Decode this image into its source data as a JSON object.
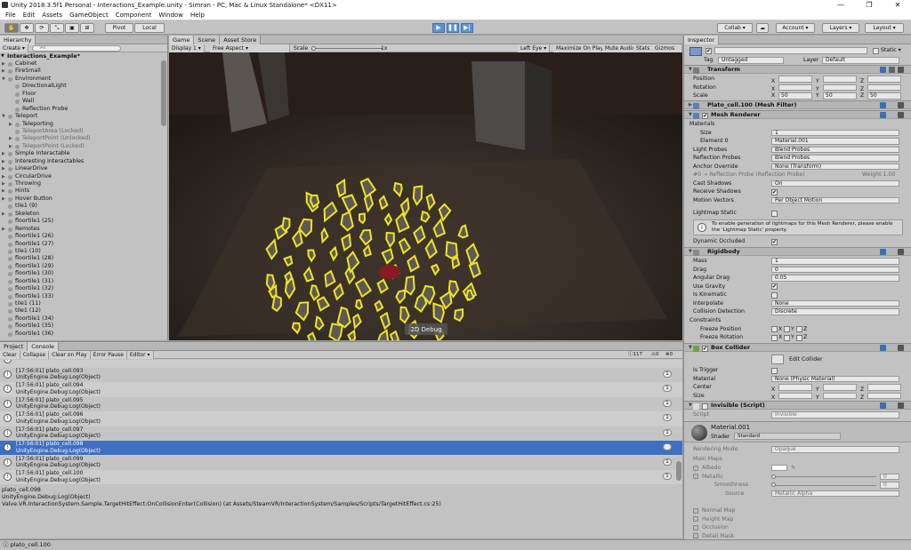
{
  "window": {
    "title": "Unity 2018.3.5f1 Personal - Interactions_Example.unity - Simran - PC, Mac & Linux Standalone* <DX11>",
    "min": "—",
    "max": "❐",
    "close": "✕"
  },
  "menu": [
    "File",
    "Edit",
    "Assets",
    "GameObject",
    "Component",
    "Window",
    "Help"
  ],
  "toolbar": {
    "pivot": "Pivot",
    "local": "Local",
    "collab": "Collab ▾",
    "account": "Account ▾",
    "layers": "Layers ▾",
    "layout": "Layout ▾"
  },
  "hierarchy": {
    "tab": "Hierarchy",
    "create": "Create ▾",
    "search": "All",
    "root": "Interactions_Example*",
    "items": [
      {
        "label": "Cabinet",
        "indent": 1,
        "arrow": true
      },
      {
        "label": "FireSmall",
        "indent": 1,
        "arrow": true
      },
      {
        "label": "Environment",
        "indent": 1,
        "arrow": true,
        "open": true
      },
      {
        "label": "DirectionalLight",
        "indent": 2
      },
      {
        "label": "Floor",
        "indent": 2
      },
      {
        "label": "Wall",
        "indent": 2
      },
      {
        "label": "Reflection Probe",
        "indent": 2
      },
      {
        "label": "Teleport",
        "indent": 1,
        "arrow": true,
        "open": true
      },
      {
        "label": "Teleporting",
        "indent": 2,
        "arrow": true
      },
      {
        "label": "TeleportArea (Locked)",
        "indent": 2,
        "dim": true
      },
      {
        "label": "TeleportPoint (Unlocked)",
        "indent": 2,
        "arrow": true,
        "dim": true
      },
      {
        "label": "TeleportPoint (Locked)",
        "indent": 2,
        "arrow": true,
        "dim": true
      },
      {
        "label": "Simple Interactable",
        "indent": 1,
        "arrow": true
      },
      {
        "label": "Interesting Interactables",
        "indent": 1,
        "arrow": true
      },
      {
        "label": "LinearDrive",
        "indent": 1,
        "arrow": true
      },
      {
        "label": "CircularDrive",
        "indent": 1,
        "arrow": true
      },
      {
        "label": "Throwing",
        "indent": 1,
        "arrow": true
      },
      {
        "label": "Hints",
        "indent": 1,
        "arrow": true
      },
      {
        "label": "Hover Button",
        "indent": 1,
        "arrow": true
      },
      {
        "label": "tile1 (9)",
        "indent": 1
      },
      {
        "label": "Skeleton",
        "indent": 1,
        "arrow": true
      },
      {
        "label": "floortile1 (25)",
        "indent": 1
      },
      {
        "label": "Remotes",
        "indent": 1,
        "arrow": true
      },
      {
        "label": "floortile1 (26)",
        "indent": 1
      },
      {
        "label": "floortile1 (27)",
        "indent": 1
      },
      {
        "label": "tile1 (10)",
        "indent": 1
      },
      {
        "label": "floortile1 (28)",
        "indent": 1
      },
      {
        "label": "floortile1 (29)",
        "indent": 1
      },
      {
        "label": "floortile1 (30)",
        "indent": 1
      },
      {
        "label": "floortile1 (31)",
        "indent": 1
      },
      {
        "label": "floortile1 (32)",
        "indent": 1
      },
      {
        "label": "floortile1 (33)",
        "indent": 1
      },
      {
        "label": "tile1 (11)",
        "indent": 1
      },
      {
        "label": "tile1 (12)",
        "indent": 1
      },
      {
        "label": "floortile1 (34)",
        "indent": 1
      },
      {
        "label": "floortile1 (35)",
        "indent": 1
      },
      {
        "label": "floortile1 (36)",
        "indent": 1
      }
    ]
  },
  "scene_tabs": {
    "game": "Game",
    "scene": "Scene",
    "store": "Asset Store"
  },
  "game_bar": {
    "display": "Display 1",
    "aspect": "Free Aspect",
    "scale": "Scale",
    "scale_val": "1x",
    "lefteye": "Left Eye",
    "maximize": "Maximize On Play",
    "mute": "Mute Audio",
    "stats": "Stats",
    "gizmos": "Gizmos ▾"
  },
  "viewport": {
    "debug_button": "2D Debug"
  },
  "console": {
    "tab_project": "Project",
    "tab_console": "Console",
    "buttons": [
      "Clear",
      "Collapse",
      "Clear on Play",
      "Error Pause",
      "Editor ▾"
    ],
    "counts": {
      "info": "117",
      "warn": "0",
      "err": "0"
    },
    "entries": [
      {
        "line1": "",
        "line2": "UnityEngine.Debug:Log(Object)",
        "count": ""
      },
      {
        "line1": "[17:56:01] plato_cell.093",
        "line2": "UnityEngine.Debug:Log(Object)",
        "count": "1"
      },
      {
        "line1": "[17:56:01] plato_cell.094",
        "line2": "UnityEngine.Debug:Log(Object)",
        "count": "1"
      },
      {
        "line1": "[17:56:01] plato_cell.095",
        "line2": "UnityEngine.Debug:Log(Object)",
        "count": "1"
      },
      {
        "line1": "[17:56:01] plato_cell.096",
        "line2": "UnityEngine.Debug:Log(Object)",
        "count": "1"
      },
      {
        "line1": "[17:56:01] plato_cell.097",
        "line2": "UnityEngine.Debug:Log(Object)",
        "count": "1"
      },
      {
        "line1": "[17:56:01] plato_cell.098",
        "line2": "UnityEngine.Debug:Log(Object)",
        "count": "1",
        "selected": true
      },
      {
        "line1": "[17:56:01] plato_cell.099",
        "line2": "UnityEngine.Debug:Log(Object)",
        "count": "1"
      },
      {
        "line1": "[17:56:01] plato_cell.100",
        "line2": "UnityEngine.Debug:Log(Object)",
        "count": "1"
      }
    ],
    "detail": [
      "plato_cell.098",
      "UnityEngine.Debug:Log(Object)",
      "Valve.VR.InteractionSystem.Sample.TargetHitEffect:OnCollisionEnter(Collision) (at Assets/SteamVR/InteractionSystem/Samples/Scripts/TargetHitEffect.cs:25)"
    ]
  },
  "status": "plato_cell.100",
  "inspector": {
    "tab": "Inspector",
    "static": "Static ▾",
    "tag_label": "Tag",
    "tag": "Untagged",
    "layer_label": "Layer",
    "layer": "Default",
    "transform": {
      "title": "Transform",
      "position": "Position",
      "rotation": "Rotation",
      "scale": "Scale",
      "scale_vals": [
        "50",
        "50",
        "50"
      ],
      "x": "X",
      "y": "Y",
      "z": "Z"
    },
    "mesh_filter": "Plato_cell.100 (Mesh Filter)",
    "mesh_renderer": {
      "title": "Mesh Renderer",
      "materials": "Materials",
      "size_label": "Size",
      "size": "1",
      "element_label": "Element 0",
      "element": "Material.001",
      "light_probes": "Light Probes",
      "light_probes_val": "Blend Probes",
      "refl_probes": "Reflection Probes",
      "refl_probes_val": "Blend Probes",
      "anchor": "Anchor Override",
      "anchor_val": "None (Transform)",
      "probe_note": "#0 → Reflection Probe (Reflection Probe)",
      "probe_weight": "Weight 1.00",
      "cast": "Cast Shadows",
      "cast_val": "On",
      "receive": "Receive Shadows",
      "motion": "Motion Vectors",
      "motion_val": "Per Object Motion",
      "lightmap": "Lightmap Static",
      "info": "To enable generation of lightmaps for this Mesh Renderer, please enable the 'Lightmap Static' property.",
      "dynamic": "Dynamic Occluded"
    },
    "rigidbody": {
      "title": "Rigidbody",
      "mass": "Mass",
      "mass_val": "1",
      "drag": "Drag",
      "drag_val": "0",
      "ang": "Angular Drag",
      "ang_val": "0.05",
      "gravity": "Use Gravity",
      "kinematic": "Is Kinematic",
      "interp": "Interpolate",
      "interp_val": "None",
      "coll": "Collision Detection",
      "coll_val": "Discrete",
      "constraints": "Constraints",
      "fpos": "Freeze Position",
      "frot": "Freeze Rotation"
    },
    "box": {
      "title": "Box Collider",
      "edit": "Edit Collider",
      "trigger": "Is Trigger",
      "material": "Material",
      "material_val": "None (Physic Material)",
      "center": "Center",
      "size": "Size"
    },
    "invisible": {
      "title": "Invisible (Script)",
      "script": "Script",
      "script_val": "Invisible"
    },
    "material": {
      "name": "Material.001",
      "shader_label": "Shader",
      "shader": "Standard",
      "rendering": "Rendering Mode",
      "rendering_val": "Opaque",
      "main": "Main Maps",
      "albedo": "Albedo",
      "metallic": "Metallic",
      "metallic_val": "0",
      "smooth": "Smoothness",
      "smooth_val": "0",
      "source": "Source",
      "source_val": "Metallic Alpha",
      "normal": "Normal Map",
      "height": "Height Map",
      "occlusion": "Occlusion",
      "detail": "Detail Mask"
    }
  }
}
